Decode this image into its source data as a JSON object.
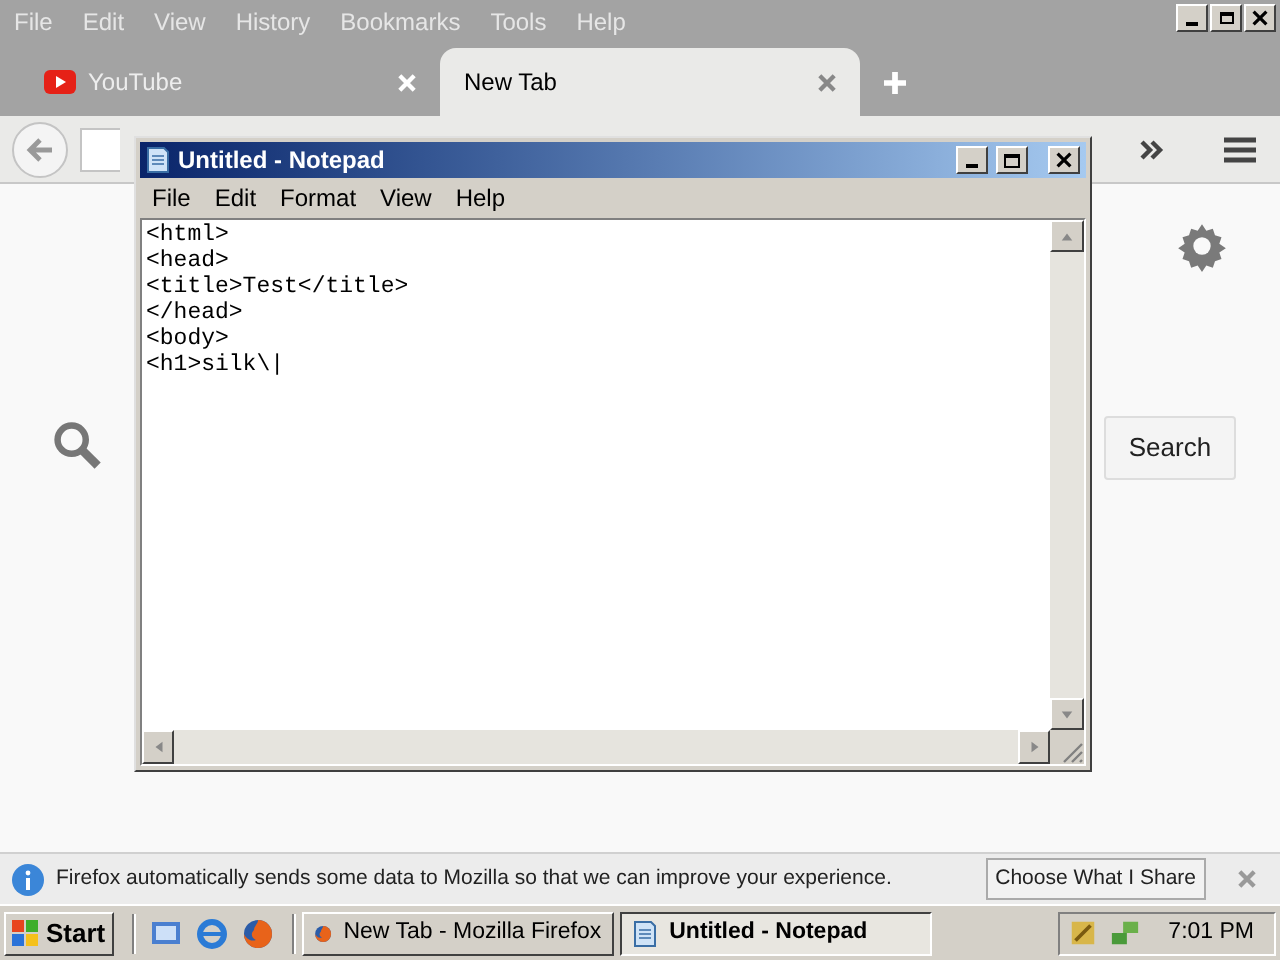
{
  "firefox": {
    "menu": [
      "File",
      "Edit",
      "View",
      "History",
      "Bookmarks",
      "Tools",
      "Help"
    ],
    "tabs": [
      {
        "label": "YouTube",
        "selected": false,
        "kind": "youtube"
      },
      {
        "label": "New Tab",
        "selected": true,
        "kind": "blank"
      }
    ],
    "search_button": "Search"
  },
  "notepad": {
    "title": "Untitled - Notepad",
    "menu": [
      "File",
      "Edit",
      "Format",
      "View",
      "Help"
    ],
    "lines": [
      "<html>",
      "<head>",
      "<title>Test</title>",
      "</head>",
      "<body>",
      "<h1>silk\\|"
    ]
  },
  "notification": {
    "text": "Firefox automatically sends some data to Mozilla so that we can improve your experience.",
    "button": "Choose What I Share"
  },
  "taskbar": {
    "start": "Start",
    "tasks": [
      {
        "label": "New Tab - Mozilla Firefox",
        "selected": false,
        "kind": "firefox"
      },
      {
        "label": "Untitled - Notepad",
        "selected": true,
        "kind": "notepad"
      }
    ],
    "clock": "7:01 PM"
  }
}
